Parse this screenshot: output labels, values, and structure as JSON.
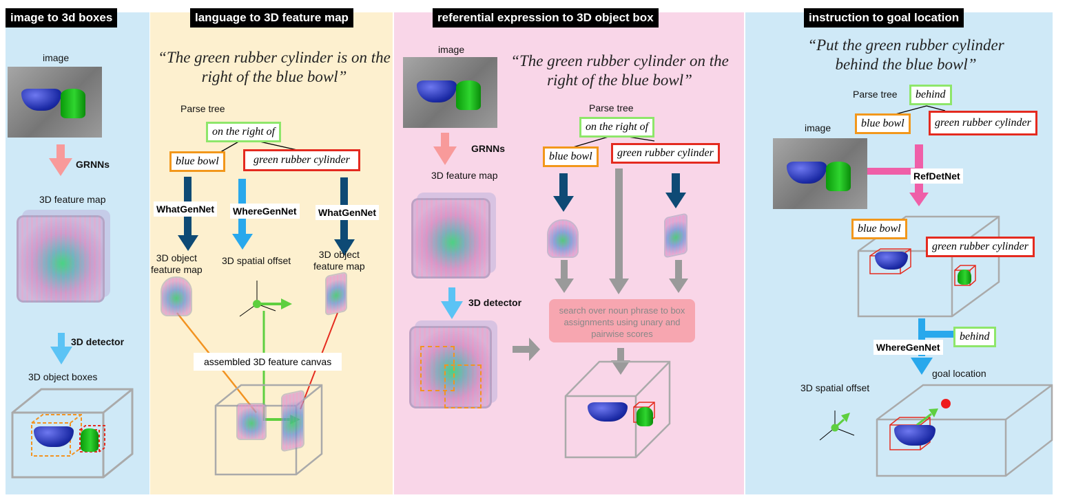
{
  "panels": {
    "p1": {
      "title": "image to 3d boxes",
      "color": "#cfe9f7"
    },
    "p2": {
      "title": "language to 3D feature map",
      "color": "#fdf0cf"
    },
    "p3": {
      "title": "referential expression to 3D object box",
      "color": "#f9d6e8"
    },
    "p4": {
      "title": "instruction to goal location",
      "color": "#cfe9f7"
    }
  },
  "p1": {
    "image_label": "image",
    "grnns": "GRNNs",
    "feature_map": "3D feature map",
    "detector": "3D detector",
    "boxes": "3D object boxes"
  },
  "p2": {
    "quote": "“The green rubber cylinder is on the right of the blue bowl”",
    "parse_tree": "Parse tree",
    "relation": "on the right of",
    "obj1": "blue bowl",
    "obj2": "green rubber cylinder",
    "whatgen1": "WhatGenNet",
    "wheregen": "WhereGenNet",
    "whatgen2": "WhatGenNet",
    "obj_map1": "3D object\nfeature map",
    "offset": "3D spatial offset",
    "obj_map2": "3D object\nfeature map",
    "canvas": "assembled 3D feature canvas"
  },
  "p3": {
    "image_label": "image",
    "quote": "“The green rubber cylinder on the right of the blue bowl”",
    "grnns": "GRNNs",
    "feature_map": "3D feature map",
    "parse_tree": "Parse tree",
    "relation": "on the right of",
    "obj1": "blue bowl",
    "obj2": "green rubber cylinder",
    "detector": "3D detector",
    "search": "search over noun phrase to box assignments using unary and pairwise scores"
  },
  "p4": {
    "quote": "“Put the green rubber cylinder behind the blue bowl”",
    "parse_tree": "Parse tree",
    "relation": "behind",
    "obj1": "blue bowl",
    "obj2": "green rubber cylinder",
    "image_label": "image",
    "refdet": "RefDetNet",
    "box_obj1": "blue bowl",
    "box_obj2": "green rubber cylinder",
    "behind2": "behind",
    "wheregen": "WhereGenNet",
    "goal": "goal location",
    "offset": "3D spatial offset"
  }
}
